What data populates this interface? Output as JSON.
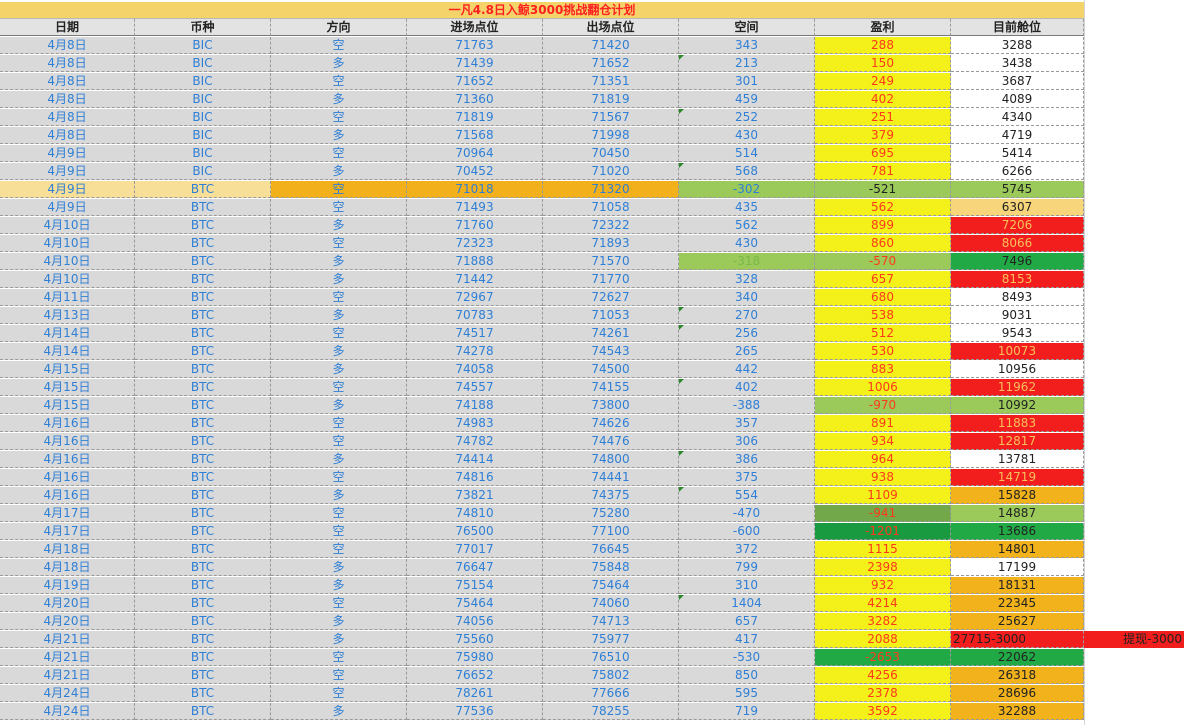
{
  "sheet": {
    "title": "一凡4.8日入鲸3000挑战翻仓计划",
    "headers": [
      "日期",
      "币种",
      "方向",
      "进场点位",
      "出场点位",
      "空间",
      "盈利",
      "目前舱位"
    ],
    "colors": {
      "white": "#ffffff",
      "red": "#f21d1d",
      "orange": "#f1b21c",
      "light_orange": "#f7d57a",
      "light_green": "#9bca5a",
      "green": "#21a945",
      "olive_green": "#72a84a",
      "dark_green": "#1a9a40",
      "profit_yellow": "#f3f01a",
      "row_highlight_light": "#f7df98",
      "row_highlight_orange": "#f2b01a",
      "space_green": "#9bca5a"
    },
    "rows": [
      {
        "date": "4月8日",
        "coin": "BIC",
        "dir": "空",
        "entry": "71763",
        "exit": "71420",
        "space": "343",
        "profit": "288",
        "pos": "3288",
        "pos_bg": "white",
        "pos_fg": "#222222"
      },
      {
        "date": "4月8日",
        "coin": "BIC",
        "dir": "多",
        "entry": "71439",
        "exit": "71652",
        "space": "213",
        "profit": "150",
        "pos": "3438",
        "pos_bg": "white",
        "pos_fg": "#222222",
        "tri": true
      },
      {
        "date": "4月8日",
        "coin": "BIC",
        "dir": "空",
        "entry": "71652",
        "exit": "71351",
        "space": "301",
        "profit": "249",
        "pos": "3687",
        "pos_bg": "white",
        "pos_fg": "#222222"
      },
      {
        "date": "4月8日",
        "coin": "BIC",
        "dir": "多",
        "entry": "71360",
        "exit": "71819",
        "space": "459",
        "profit": "402",
        "pos": "4089",
        "pos_bg": "white",
        "pos_fg": "#222222"
      },
      {
        "date": "4月8日",
        "coin": "BIC",
        "dir": "空",
        "entry": "71819",
        "exit": "71567",
        "space": "252",
        "profit": "251",
        "pos": "4340",
        "pos_bg": "white",
        "pos_fg": "#222222",
        "tri": true
      },
      {
        "date": "4月8日",
        "coin": "BIC",
        "dir": "多",
        "entry": "71568",
        "exit": "71998",
        "space": "430",
        "profit": "379",
        "pos": "4719",
        "pos_bg": "white",
        "pos_fg": "#222222"
      },
      {
        "date": "4月9日",
        "coin": "BIC",
        "dir": "空",
        "entry": "70964",
        "exit": "70450",
        "space": "514",
        "profit": "695",
        "pos": "5414",
        "pos_bg": "white",
        "pos_fg": "#222222"
      },
      {
        "date": "4月9日",
        "coin": "BIC",
        "dir": "多",
        "entry": "70452",
        "exit": "71020",
        "space": "568",
        "profit": "781",
        "pos": "6266",
        "pos_bg": "white",
        "pos_fg": "#222222",
        "tri": true
      },
      {
        "date": "4月9日",
        "coin": "BTC",
        "dir": "空",
        "entry": "71018",
        "exit": "71320",
        "space": "-302",
        "profit": "-521",
        "pos": "5745",
        "pos_bg": "light_green",
        "pos_fg": "#222222",
        "highlight": true
      },
      {
        "date": "4月9日",
        "coin": "BTC",
        "dir": "空",
        "entry": "71493",
        "exit": "71058",
        "space": "435",
        "profit": "562",
        "pos": "6307",
        "pos_bg": "light_orange",
        "pos_fg": "#222222"
      },
      {
        "date": "4月10日",
        "coin": "BTC",
        "dir": "多",
        "entry": "71760",
        "exit": "72322",
        "space": "562",
        "profit": "899",
        "pos": "7206",
        "pos_bg": "red",
        "pos_fg": "#f7c05a"
      },
      {
        "date": "4月10日",
        "coin": "BTC",
        "dir": "空",
        "entry": "72323",
        "exit": "71893",
        "space": "430",
        "profit": "860",
        "pos": "8066",
        "pos_bg": "red",
        "pos_fg": "#f7c05a"
      },
      {
        "date": "4月10日",
        "coin": "BTC",
        "dir": "多",
        "entry": "71888",
        "exit": "71570",
        "space": "-318",
        "profit": "-570",
        "pos": "7496",
        "pos_bg": "green",
        "pos_fg": "#222222",
        "space_bg": "light_green",
        "profit_bg": "light_green"
      },
      {
        "date": "4月10日",
        "coin": "BTC",
        "dir": "多",
        "entry": "71442",
        "exit": "71770",
        "space": "328",
        "profit": "657",
        "pos": "8153",
        "pos_bg": "red",
        "pos_fg": "#f7c05a"
      },
      {
        "date": "4月11日",
        "coin": "BTC",
        "dir": "空",
        "entry": "72967",
        "exit": "72627",
        "space": "340",
        "profit": "680",
        "pos": "8493",
        "pos_bg": "white",
        "pos_fg": "#222222"
      },
      {
        "date": "4月13日",
        "coin": "BTC",
        "dir": "多",
        "entry": "70783",
        "exit": "71053",
        "space": "270",
        "profit": "538",
        "pos": "9031",
        "pos_bg": "white",
        "pos_fg": "#222222",
        "tri": true
      },
      {
        "date": "4月14日",
        "coin": "BTC",
        "dir": "空",
        "entry": "74517",
        "exit": "74261",
        "space": "256",
        "profit": "512",
        "pos": "9543",
        "pos_bg": "white",
        "pos_fg": "#222222",
        "tri": true
      },
      {
        "date": "4月14日",
        "coin": "BTC",
        "dir": "多",
        "entry": "74278",
        "exit": "74543",
        "space": "265",
        "profit": "530",
        "pos": "10073",
        "pos_bg": "red",
        "pos_fg": "#f7c05a"
      },
      {
        "date": "4月15日",
        "coin": "BTC",
        "dir": "多",
        "entry": "74058",
        "exit": "74500",
        "space": "442",
        "profit": "883",
        "pos": "10956",
        "pos_bg": "white",
        "pos_fg": "#222222"
      },
      {
        "date": "4月15日",
        "coin": "BTC",
        "dir": "空",
        "entry": "74557",
        "exit": "74155",
        "space": "402",
        "profit": "1006",
        "pos": "11962",
        "pos_bg": "red",
        "pos_fg": "#f7c05a",
        "tri": true
      },
      {
        "date": "4月15日",
        "coin": "BTC",
        "dir": "多",
        "entry": "74188",
        "exit": "73800",
        "space": "-388",
        "profit": "-970",
        "pos": "10992",
        "pos_bg": "light_green",
        "pos_fg": "#222222",
        "profit_bg": "light_green"
      },
      {
        "date": "4月16日",
        "coin": "BTC",
        "dir": "空",
        "entry": "74983",
        "exit": "74626",
        "space": "357",
        "profit": "891",
        "pos": "11883",
        "pos_bg": "red",
        "pos_fg": "#f7c05a"
      },
      {
        "date": "4月16日",
        "coin": "BTC",
        "dir": "空",
        "entry": "74782",
        "exit": "74476",
        "space": "306",
        "profit": "934",
        "pos": "12817",
        "pos_bg": "red",
        "pos_fg": "#f7c05a"
      },
      {
        "date": "4月16日",
        "coin": "BTC",
        "dir": "多",
        "entry": "74414",
        "exit": "74800",
        "space": "386",
        "profit": "964",
        "pos": "13781",
        "pos_bg": "white",
        "pos_fg": "#222222",
        "tri": true
      },
      {
        "date": "4月16日",
        "coin": "BTC",
        "dir": "空",
        "entry": "74816",
        "exit": "74441",
        "space": "375",
        "profit": "938",
        "pos": "14719",
        "pos_bg": "red",
        "pos_fg": "#f7c05a"
      },
      {
        "date": "4月16日",
        "coin": "BTC",
        "dir": "多",
        "entry": "73821",
        "exit": "74375",
        "space": "554",
        "profit": "1109",
        "pos": "15828",
        "pos_bg": "orange",
        "pos_fg": "#222222",
        "tri": true
      },
      {
        "date": "4月17日",
        "coin": "BTC",
        "dir": "空",
        "entry": "74810",
        "exit": "75280",
        "space": "-470",
        "profit": "-941",
        "pos": "14887",
        "pos_bg": "light_green",
        "pos_fg": "#222222",
        "profit_bg": "olive_green"
      },
      {
        "date": "4月17日",
        "coin": "BTC",
        "dir": "空",
        "entry": "76500",
        "exit": "77100",
        "space": "-600",
        "profit": "-1201",
        "pos": "13686",
        "pos_bg": "green",
        "pos_fg": "#222222",
        "profit_bg": "dark_green"
      },
      {
        "date": "4月18日",
        "coin": "BTC",
        "dir": "空",
        "entry": "77017",
        "exit": "76645",
        "space": "372",
        "profit": "1115",
        "pos": "14801",
        "pos_bg": "orange",
        "pos_fg": "#222222"
      },
      {
        "date": "4月18日",
        "coin": "BTC",
        "dir": "多",
        "entry": "76647",
        "exit": "75848",
        "space": "799",
        "profit": "2398",
        "pos": "17199",
        "pos_bg": "white",
        "pos_fg": "#222222"
      },
      {
        "date": "4月19日",
        "coin": "BTC",
        "dir": "多",
        "entry": "75154",
        "exit": "75464",
        "space": "310",
        "profit": "932",
        "pos": "18131",
        "pos_bg": "orange",
        "pos_fg": "#222222"
      },
      {
        "date": "4月20日",
        "coin": "BTC",
        "dir": "空",
        "entry": "75464",
        "exit": "74060",
        "space": "1404",
        "profit": "4214",
        "pos": "22345",
        "pos_bg": "orange",
        "pos_fg": "#222222",
        "tri": true
      },
      {
        "date": "4月20日",
        "coin": "BTC",
        "dir": "多",
        "entry": "74056",
        "exit": "74713",
        "space": "657",
        "profit": "3282",
        "pos": "25627",
        "pos_bg": "orange",
        "pos_fg": "#222222"
      },
      {
        "date": "4月21日",
        "coin": "BTC",
        "dir": "多",
        "entry": "75560",
        "exit": "75977",
        "space": "417",
        "profit": "2088",
        "pos": "27715-3000",
        "pos_bg": "red",
        "pos_fg": "#222222",
        "pos_left": true,
        "extra": "提现-3000"
      },
      {
        "date": "4月21日",
        "coin": "BTC",
        "dir": "空",
        "entry": "75980",
        "exit": "76510",
        "space": "-530",
        "profit": "-2653",
        "pos": "22062",
        "pos_bg": "green",
        "pos_fg": "#222222",
        "profit_bg": "green"
      },
      {
        "date": "4月21日",
        "coin": "BTC",
        "dir": "空",
        "entry": "76652",
        "exit": "75802",
        "space": "850",
        "profit": "4256",
        "pos": "26318",
        "pos_bg": "orange",
        "pos_fg": "#222222"
      },
      {
        "date": "4月24日",
        "coin": "BTC",
        "dir": "空",
        "entry": "78261",
        "exit": "77666",
        "space": "595",
        "profit": "2378",
        "pos": "28696",
        "pos_bg": "orange",
        "pos_fg": "#222222"
      },
      {
        "date": "4月24日",
        "coin": "BTC",
        "dir": "多",
        "entry": "77536",
        "exit": "78255",
        "space": "719",
        "profit": "3592",
        "pos": "32288",
        "pos_bg": "orange",
        "pos_fg": "#222222"
      }
    ]
  }
}
